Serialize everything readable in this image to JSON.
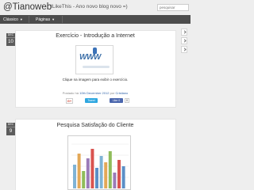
{
  "header": {
    "title": "@Tianoweb",
    "description": "!LikeThis - Ano novo blog novo =)",
    "search_placeholder": "pesquisar"
  },
  "nav": {
    "items": [
      {
        "label": "Clássico",
        "caret": "▼"
      },
      {
        "label": "Páginas",
        "caret": "▼"
      }
    ]
  },
  "posts": [
    {
      "month": "DEC",
      "day": "10",
      "title": "Exercício - Introdução a Internet",
      "image_text": "WWW",
      "caption": "Clique na imagem para exibir o exercício.",
      "meta_prefix": "Postado há",
      "date_link": "10th December 2012",
      "meta_by": "por",
      "author": "Cristiano",
      "share": {
        "gplus": "G+",
        "tweet": "Tweet",
        "like": "Like 0",
        "count": "0"
      }
    },
    {
      "month": "DEC",
      "day": "9",
      "title": "Pesquisa Satisfação do Cliente"
    }
  ],
  "colors": {
    "navbar": "#4d4d4d",
    "date_badge": "#5c5c5c",
    "chart_bars": [
      "#7fb3d5",
      "#e3a857",
      "#8fbc5a",
      "#9b7bb8",
      "#d9534f",
      "#5b8fc7"
    ]
  },
  "icons": {
    "side_arrow": "chevron-right-icon",
    "search": "search-field"
  }
}
